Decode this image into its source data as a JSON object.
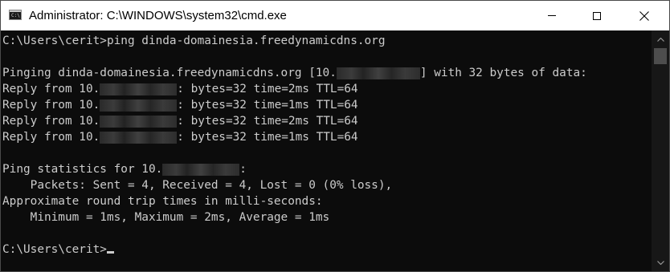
{
  "window": {
    "title": "Administrator: C:\\WINDOWS\\system32\\cmd.exe",
    "icon_name": "cmd-app-icon",
    "icon_glyph": "C:\\"
  },
  "console": {
    "lines": [
      {
        "text": "C:\\Users\\cerit>ping dinda-domainesia.freedynamicdns.org"
      },
      {
        "text": ""
      },
      {
        "before": "Pinging dinda-domainesia.freedynamicdns.org [10.",
        "after": "] with 32 bytes of data:"
      },
      {
        "before": "Reply from 10.",
        "after": ": bytes=32 time=2ms TTL=64"
      },
      {
        "before": "Reply from 10.",
        "after": ": bytes=32 time=1ms TTL=64"
      },
      {
        "before": "Reply from 10.",
        "after": ": bytes=32 time=2ms TTL=64"
      },
      {
        "before": "Reply from 10.",
        "after": ": bytes=32 time=1ms TTL=64"
      },
      {
        "text": ""
      },
      {
        "before": "Ping statistics for 10.",
        "after": ":"
      },
      {
        "text": "    Packets: Sent = 4, Received = 4, Lost = 0 (0% loss),"
      },
      {
        "text": "Approximate round trip times in milli-seconds:"
      },
      {
        "text": "    Minimum = 1ms, Maximum = 2ms, Average = 1ms"
      },
      {
        "text": ""
      },
      {
        "text": "C:\\Users\\cerit>"
      }
    ]
  },
  "colors": {
    "console_bg": "#0c0c0c",
    "console_text": "#cccccc",
    "titlebar_bg": "#ffffff",
    "scrollbar_bg": "#171717",
    "scrollbar_thumb": "#4d4d4d"
  }
}
